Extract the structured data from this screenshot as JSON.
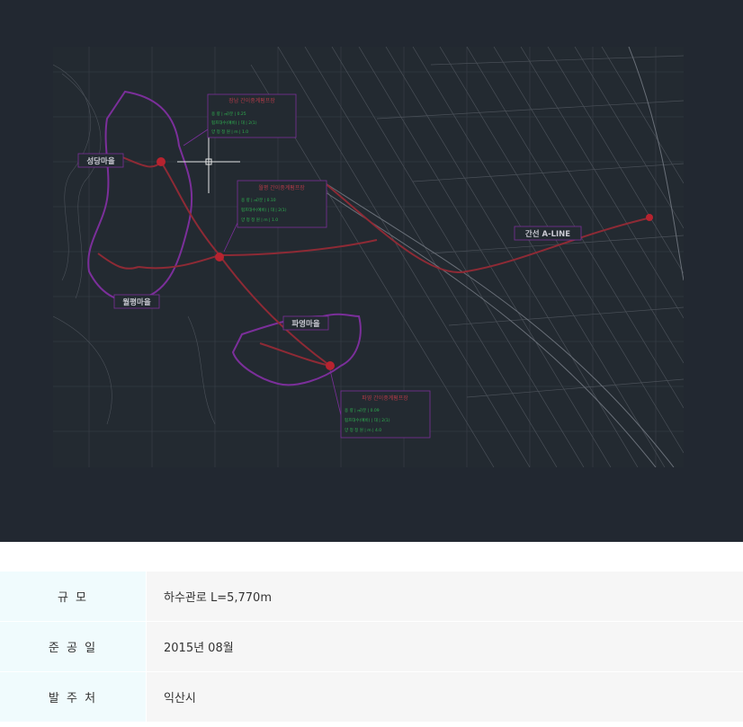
{
  "drawing": {
    "labels": {
      "village1": "성당마을",
      "village2": "월평마을",
      "village3": "파영마을",
      "mainline": "간선 A-LINE"
    },
    "pump_tables": [
      {
        "title": "장남 간이중계펌프장",
        "rows": [
          "용        량 | ㎥/분 | 0.25",
          "펌프대수(예비) | 대 | 2(1)",
          "양 정 정 원 | m | 1.0"
        ]
      },
      {
        "title": "월평 간이중계펌프장",
        "rows": [
          "용        량 | ㎥/분 | 0.10",
          "펌프대수(예비) | 대 | 2(1)",
          "양 정 정 원 | m | 1.0"
        ]
      },
      {
        "title": "파영 간이중계펌프장",
        "rows": [
          "용        량 | ㎥/분 | 0.09",
          "펌프대수(예비) | 대 | 2(1)",
          "양 정 정 원 | m | 4.0"
        ]
      }
    ],
    "colors": {
      "viewer_bg": "#222831",
      "pipe": "#8e2a35",
      "boundary": "#7b2f9a",
      "grid": "#3a424a",
      "label_box": "#7b2f9a"
    }
  },
  "info": [
    {
      "key": "규    모",
      "value": "하수관로 L=5,770m"
    },
    {
      "key": "준 공 일",
      "value": "2015년 08월"
    },
    {
      "key": "발 주 처",
      "value": "익산시"
    }
  ]
}
